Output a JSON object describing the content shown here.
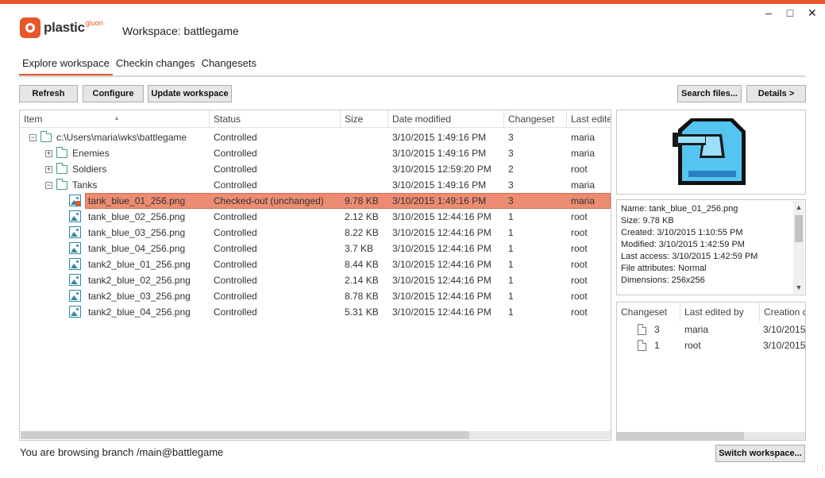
{
  "app": {
    "logo_text": "plastic",
    "logo_sup": "gluon",
    "title": "Workspace: battlegame",
    "window_controls": {
      "minimize": "–",
      "maximize": "□",
      "close": "✕"
    }
  },
  "tabs": [
    {
      "label": "Explore workspace",
      "active": true
    },
    {
      "label": "Checkin changes",
      "active": false
    },
    {
      "label": "Changesets",
      "active": false
    }
  ],
  "toolbar": {
    "refresh": "Refresh",
    "configure": "Configure",
    "update": "Update workspace",
    "search": "Search files...",
    "details": "Details >"
  },
  "grid": {
    "columns": [
      "Item",
      "Status",
      "Size",
      "Date modified",
      "Changeset",
      "Last edite"
    ],
    "rows": [
      {
        "name": "c:\\Users\\maria\\wks\\battlegame",
        "type": "folder",
        "level": 0,
        "expander": "−",
        "status": "Controlled",
        "size": "",
        "date": "3/10/2015 1:49:16 PM",
        "changeset": "3",
        "last_edited": "maria",
        "selected": false
      },
      {
        "name": "Enemies",
        "type": "folder",
        "level": 1,
        "expander": "+",
        "status": "Controlled",
        "size": "",
        "date": "3/10/2015 1:49:16 PM",
        "changeset": "3",
        "last_edited": "maria",
        "selected": false
      },
      {
        "name": "Soldiers",
        "type": "folder",
        "level": 1,
        "expander": "+",
        "status": "Controlled",
        "size": "",
        "date": "3/10/2015 12:59:20 PM",
        "changeset": "2",
        "last_edited": "root",
        "selected": false
      },
      {
        "name": "Tanks",
        "type": "folder",
        "level": 1,
        "expander": "−",
        "status": "Controlled",
        "size": "",
        "date": "3/10/2015 1:49:16 PM",
        "changeset": "3",
        "last_edited": "maria",
        "selected": false
      },
      {
        "name": "tank_blue_01_256.png",
        "type": "image",
        "level": 2,
        "expander": "",
        "status": "Checked-out (unchanged)",
        "size": "9.78 KB",
        "date": "3/10/2015 1:49:16 PM",
        "changeset": "3",
        "last_edited": "maria",
        "selected": true
      },
      {
        "name": "tank_blue_02_256.png",
        "type": "image",
        "level": 2,
        "expander": "",
        "status": "Controlled",
        "size": "2.12 KB",
        "date": "3/10/2015 12:44:16 PM",
        "changeset": "1",
        "last_edited": "root",
        "selected": false
      },
      {
        "name": "tank_blue_03_256.png",
        "type": "image",
        "level": 2,
        "expander": "",
        "status": "Controlled",
        "size": "8.22 KB",
        "date": "3/10/2015 12:44:16 PM",
        "changeset": "1",
        "last_edited": "root",
        "selected": false
      },
      {
        "name": "tank_blue_04_256.png",
        "type": "image",
        "level": 2,
        "expander": "",
        "status": "Controlled",
        "size": "3.7 KB",
        "date": "3/10/2015 12:44:16 PM",
        "changeset": "1",
        "last_edited": "root",
        "selected": false
      },
      {
        "name": "tank2_blue_01_256.png",
        "type": "image",
        "level": 2,
        "expander": "",
        "status": "Controlled",
        "size": "8.44 KB",
        "date": "3/10/2015 12:44:16 PM",
        "changeset": "1",
        "last_edited": "root",
        "selected": false
      },
      {
        "name": "tank2_blue_02_256.png",
        "type": "image",
        "level": 2,
        "expander": "",
        "status": "Controlled",
        "size": "2.14 KB",
        "date": "3/10/2015 12:44:16 PM",
        "changeset": "1",
        "last_edited": "root",
        "selected": false
      },
      {
        "name": "tank2_blue_03_256.png",
        "type": "image",
        "level": 2,
        "expander": "",
        "status": "Controlled",
        "size": "8.78 KB",
        "date": "3/10/2015 12:44:16 PM",
        "changeset": "1",
        "last_edited": "root",
        "selected": false
      },
      {
        "name": "tank2_blue_04_256.png",
        "type": "image",
        "level": 2,
        "expander": "",
        "status": "Controlled",
        "size": "5.31 KB",
        "date": "3/10/2015 12:44:16 PM",
        "changeset": "1",
        "last_edited": "root",
        "selected": false
      }
    ]
  },
  "details": {
    "lines": [
      "Name: tank_blue_01_256.png",
      "Size: 9.78 KB",
      "Created: 3/10/2015 1:10:55 PM",
      "Modified: 3/10/2015 1:42:59 PM",
      "Last access: 3/10/2015 1:42:59 PM",
      "File attributes: Normal",
      "Dimensions: 256x256"
    ]
  },
  "history": {
    "columns": [
      "Changeset",
      "Last edited by",
      "Creation d"
    ],
    "rows": [
      {
        "changeset": "3",
        "user": "maria",
        "date": "3/10/2015"
      },
      {
        "changeset": "1",
        "user": "root",
        "date": "3/10/2015"
      }
    ]
  },
  "statusbar": {
    "text": "You are browsing branch /main@battlegame",
    "switch_button": "Switch workspace..."
  },
  "colors": {
    "accent": "#e8572a",
    "selection": "#ec8c72",
    "icon_teal": "#3f9c8c",
    "preview_blue": "#54c5f0"
  }
}
